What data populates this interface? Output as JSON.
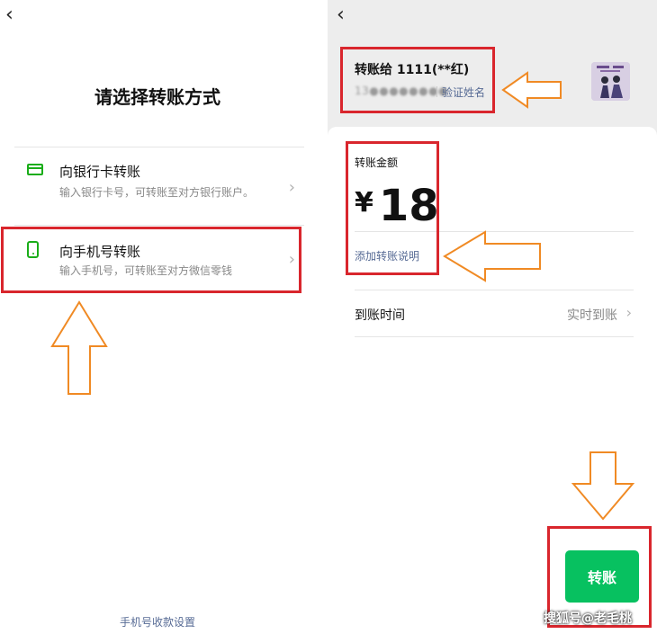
{
  "left": {
    "page_title": "请选择转账方式",
    "options": [
      {
        "title": "向银行卡转账",
        "desc": "输入银行卡号，可转账至对方银行账户。",
        "icon": "bank-card-icon"
      },
      {
        "title": "向手机号转账",
        "desc": "输入手机号，可转账至对方微信零钱",
        "icon": "mobile-phone-icon"
      }
    ],
    "footer_link": "手机号收款设置"
  },
  "right": {
    "payee_name": "转账给 1111(**红)",
    "payee_phone": "13●●●●●●●●",
    "verify_link": "验证姓名",
    "amount_label": "转账金额",
    "currency": "¥",
    "amount": "18",
    "note_link": "添加转账说明",
    "arrival_label": "到账时间",
    "arrival_value": "实时到账",
    "transfer_button": "转账"
  },
  "watermark": "搜狐号@老毛桃",
  "colors": {
    "brand_green": "#07c160",
    "link_blue": "#576b95",
    "annotation_red": "#d9262d",
    "annotation_arrow": "#f08a24"
  }
}
